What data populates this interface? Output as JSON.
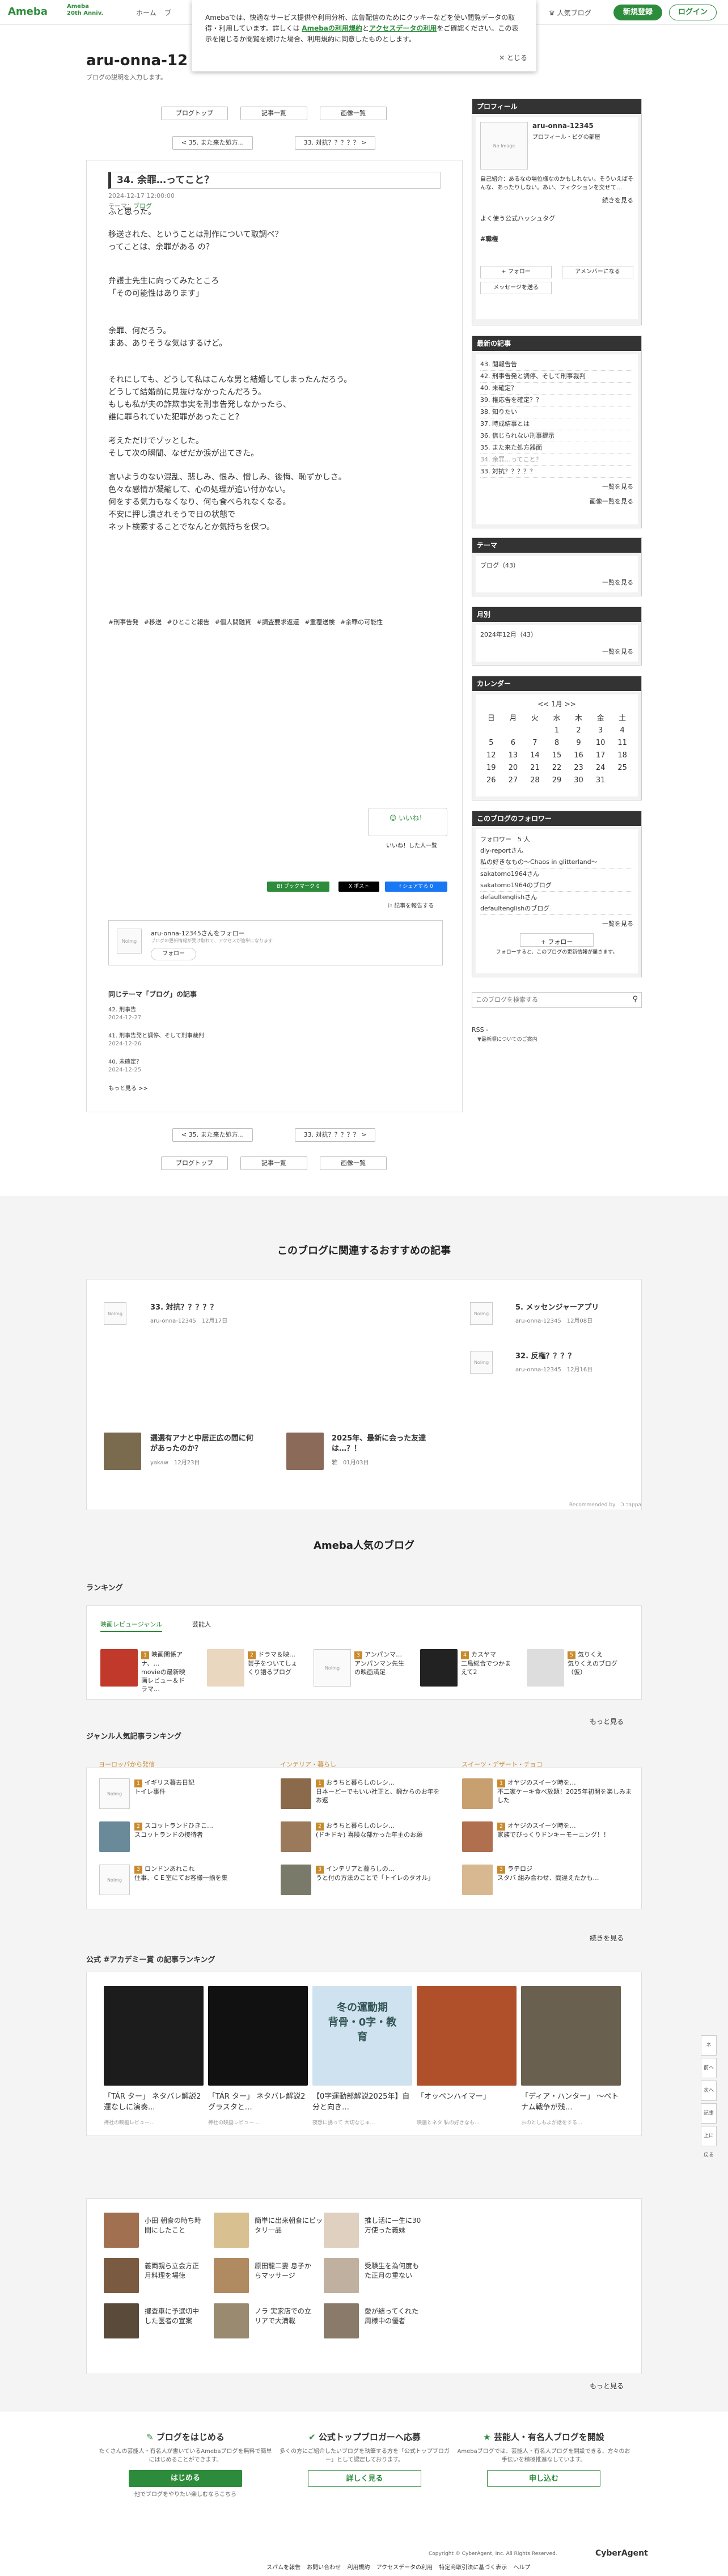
{
  "header": {
    "logo": "Ameba",
    "logo_sub": "Ameba\n20th Anniv.",
    "nav": [
      "ホーム",
      "ブ"
    ],
    "popular": "人気ブログ",
    "signup": "新規登録",
    "login": "ログイン"
  },
  "popup": {
    "text1": "Amebaでは、快適なサービス提供や利用分析、広告配信のためにクッキーなどを使い閲覧データの取得・利用しています。詳しくは",
    "link1": "Amebaの利用規約",
    "and": "と",
    "link2": "アクセスデータの利用",
    "text2": "をご確認ください。この表示を閉じるか閲覧を続けた場合、利用規約に同意したものとします。",
    "close": "✕ とじる"
  },
  "blog": {
    "title": "aru-onna-12",
    "desc": "ブログの説明を入力します。",
    "btn_top": "ブログトップ",
    "btn_list": "記事一覧",
    "btn_images": "画像一覧",
    "prev": "< 35. また来た処方...",
    "next": "33. 対抗？？？？？ >"
  },
  "article": {
    "title": "34. 余罪…ってこと？",
    "date": "2024-12-17 12:00:00",
    "theme": "テーマ：",
    "theme_link": "ブログ",
    "paras": [
      "ふと思った。",
      "移送された、ということは刑作について取調べ？\nってことは、余罪がある の？",
      "弁護士先生に向ってみたところ\n「その可能性はあります」",
      "余罪、何だろう。\nまあ、ありそうな気はするけど。",
      "それにしても、どうして私はこんな男と結婚してしまったんだろう。\nどうして結婚前に見抜けなかったんだろう。\nもしも私が夫の詐欺事実を刑事告発しなかったら、\n誰に罪られていた犯罪があったこと？",
      "考えただけでゾッとした。\nそして次の瞬間、なぜだか涙が出てきた。",
      "言いようのない混乱、悲しみ、恨み、憎しみ、後悔、恥ずかしさ。\n色々な感情が凝縮して、心の処理が追い付かない。\n何をする気力もなくなり、何も食べられなくなる。\n不安に押し潰されそうで日の状態で\nネット検索することでなんとか気持ちを保つ。"
    ],
    "tags": "#刑事告発 #移送 #ひとこと報告 #個人間融資 #調査要求返還 #重覆送検 #余罪の可能性",
    "like": "いいね！",
    "like_sub": "いいね！した人一覧",
    "share": [
      "B! ブックマーク 0",
      "X ポスト",
      "f シェアする 0"
    ],
    "report": "記事を報告する",
    "follow_name": "aru-onna-12345さんをフォロー",
    "follow_sub": "ブログの更新情報が受け取れて、アクセスが簡単になります",
    "follow_btn": "フォロー",
    "same_theme": "同じテーマ「ブログ」の記事",
    "related": [
      {
        "t": "42. 刑事告",
        "d": "2024-12-27"
      },
      {
        "t": "41. 刑事告発と調停、そして刑事裁判",
        "d": "2024-12-26"
      },
      {
        "t": "40. 未確定？",
        "d": "2024-12-25"
      }
    ],
    "more": "もっと見る >>"
  },
  "sidebar": {
    "profile_h": "プロフィール",
    "name": "aru-onna-12345",
    "sub": "プロフィール・ピグの部屋",
    "desc": "自己紹介：あるなの場位様なのかもしれない。そういえばそんな、あったりしない。あい、フィクションを交ぜて…",
    "more": "続きを見る",
    "hashtag_label": "よく使う公式ハッシュタグ",
    "hashtag": "#職権",
    "follow": "+ フォロー",
    "amember": "アメンバーになる",
    "message": "メッセージを送る",
    "recent_h": "最新の記事",
    "recent": [
      "43. 閲報告告",
      "42. 刑事告発と調停、そして刑事裁判",
      "40. 未確定？",
      "39. 権応告を確定？？",
      "38. 知りたい",
      "37. 時成結事とは",
      "36. 信じられない刑事提示",
      "35. また来た処方器面",
      "34. 余罪…ってこと？",
      "33. 対抗？？？？？"
    ],
    "recent_more": "一覧を見る",
    "image_list": "画像一覧を見る",
    "theme_h": "テーマ",
    "theme": "ブログ（43）",
    "theme_more": "一覧を見る",
    "month_h": "月別",
    "month": "2024年12月（43）",
    "month_more": "一覧を見る",
    "cal_h": "カレンダー",
    "cal_title": "<< 1月 >>",
    "cal_days": [
      "日",
      "月",
      "火",
      "水",
      "木",
      "金",
      "土"
    ],
    "cal_rows": [
      [
        "",
        "",
        "",
        "1",
        "2",
        "3",
        "4"
      ],
      [
        "5",
        "6",
        "7",
        "8",
        "9",
        "10",
        "11"
      ],
      [
        "12",
        "13",
        "14",
        "15",
        "16",
        "17",
        "18"
      ],
      [
        "19",
        "20",
        "21",
        "22",
        "23",
        "24",
        "25"
      ],
      [
        "26",
        "27",
        "28",
        "29",
        "30",
        "31",
        ""
      ]
    ],
    "fol_h": "このブログのフォロワー",
    "fol_count": "フォロワー　5 人",
    "followers": [
      "diy-reportさん",
      "私の好きなもの〜Chaos in glitterland〜",
      "sakatomo1964さん",
      "sakatomo1964のブログ",
      "defaultenglishさん",
      "defaultenglishのブログ"
    ],
    "fol_more": "一覧を見る",
    "fol_btn": "+ フォロー",
    "fol_note": "フォローすると、このブログの更新情報が届きます。",
    "search_ph": "このブログを検索する",
    "rss": "RSS -",
    "rss_sub": "▼最新順についてのご案内"
  },
  "reco": {
    "title": "このブログに関連するおすすめの記事",
    "items": [
      {
        "t": "33. 対抗？？？？？",
        "m": "aru-onna-12345　12月17日"
      },
      {
        "t": "5. メッセンジャーアプリ",
        "m": "aru-onna-12345　12月08日"
      },
      {
        "t": "32. 反権？？？？",
        "m": "aru-onna-12345　12月16日"
      },
      {
        "t": "選選有アナと中居正広の間に何があったのか？",
        "m": "yakaw　12月23日"
      },
      {
        "t": "2025年、最新に会った友達は…？！",
        "m": "雅　01月03日"
      }
    ],
    "powered": "Recommended by　Ɔ ɔappa"
  },
  "popular": {
    "title": "Ameba人気のブログ",
    "ranking": "ランキング",
    "tabs": [
      "映画レビュージャンル",
      "芸能人"
    ],
    "rank": [
      {
        "n": "1",
        "t": "映画関係アナ、…\nmovieの最新映画レビュー＆ドラマ…"
      },
      {
        "n": "2",
        "t": "ドラマ＆映…\n芸子をついてしょくり語るブログ"
      },
      {
        "n": "3",
        "t": "アンパンマ…\nアンパンマン先生の映画満足"
      },
      {
        "n": "4",
        "t": "カスヤマ\n二鳥総合でつかまえて2"
      },
      {
        "n": "5",
        "t": "気りくえ\n気りくえのブログ（仮）"
      }
    ],
    "rank_more": "もっと見る",
    "genre": "ジャンル人気記事ランキング",
    "cols": [
      {
        "h": "ヨーロッパから発信",
        "items": [
          "イギリス暮去日記\nトイレ事件",
          "スコットランドひきこ…\nスコットランドの接待者",
          "ロンドンあれこれ\n住事、ＣＥ室にてお客様一揃を集"
        ]
      },
      {
        "h": "インテリア・暮らし",
        "items": [
          "おうちと暮らしのレシ…\n日本ーどーでもいい社正と、鍛からのお年をお返",
          "おうちと暮らしのレシ…\n(ドキドキ) 喜険な部かった年主のお願",
          "インテリアと暮らしの…\nうと付の方法のことで「トイレのタオル」"
        ]
      },
      {
        "h": "スイーツ・デザート・チョコ",
        "items": [
          "オヤジのスイーツ時を…\n不二家ケーキ食べ放題！2025年初開を楽しみました",
          "オヤジのスイーツ時を…\n家族でびっくりドンキーモーニング！！",
          "ラテロジ\nスタバ 組み合わせ、間違えたかも…"
        ]
      }
    ],
    "genre_more": "続きを見る",
    "academy": "公式 #アカデミー賞 の記事ランキング",
    "films": [
      "「TÁR ター」 ネタバレ解説2 運なしに演奏...",
      "「TÁR ター」 ネタバレ解説2 グラスタと…",
      "【0字運動部解説2025年】自分と向き…",
      "「オッペンハイマー」",
      "「ディア・ハンター」 〜ベトナム戦争が残…"
    ],
    "films_sub": [
      "神社の映画レビュー…",
      "神社の映画レビュー…",
      "夜想に誘って 大切なじゅ…",
      "映画とネタ 私の好きなも…",
      "おのとしもよが話をする…"
    ],
    "cool": "冬の運動期\n背骨・0字・教育",
    "news_items": [
      "小田 朝食の時ち時間にしたこと",
      "簡単に出来朝食にピッタリ一品",
      "推し活に一生に30万使った義妹",
      "義両親ら立会方正月料理を場徳",
      "原田龍二妻 息子からマッサージ",
      "受験生を為何度もた正月の重ない",
      "攫査車に予選切中した医者の宣案",
      "ノラ 実家店での立リアで大満載",
      "愛が結ってくれた周様中の優者"
    ],
    "news_more": "もっと見る"
  },
  "footer": {
    "c1_h": "ブログをはじめる",
    "c1_p": "たくさんの芸能人・有名人が書いているAmebaブログを無料で簡単にはじめることができます。",
    "c1_btn": "はじめる",
    "c1_sub": "他でブログをやりたい楽しむならこちら",
    "c2_h": "公式トップブロガーへ応募",
    "c2_p": "多くの方にご紹介したいブログを執筆する方を「公式トップブロガー」として認定しております。",
    "c2_btn": "詳しく見る",
    "c3_h": "芸能人・有名人ブログを開設",
    "c3_p": "Amebaブログでは、芸能人・有名人ブログを開設できる、方々のお手伝いを積極推進なしています。",
    "c3_btn": "申し込む",
    "copyright": "Copyright © CyberAgent, Inc. All Rights Reserved.",
    "ca": "CyberAgent",
    "links": [
      "スパムを報告",
      "お問い合わせ",
      "利用規約",
      "アクセスデータの利用",
      "特定商取引法に基づく表示",
      "ヘルプ"
    ]
  },
  "floatnav": [
    "ネ　ト",
    "前へ",
    "次へ",
    "記事一覧",
    "上に戻る"
  ],
  "colors": {
    "accent": "#2d8c3c",
    "dark": "#333333",
    "gold": "#c98a2c"
  }
}
